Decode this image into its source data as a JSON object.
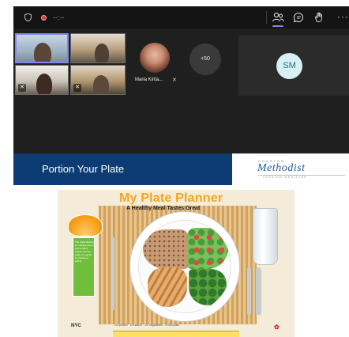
{
  "meeting": {
    "timer_text": "--:--",
    "more_label": "···",
    "participant_name": "Maria Kirtla...",
    "overflow_count": "+50",
    "sm_initials": "SM",
    "colors": {
      "accent": "#7f85f5",
      "recording": "#e03c3c",
      "stage_bg": "#1f1f1f"
    }
  },
  "slide": {
    "title": "Portion Your Plate",
    "logo_small": "HOUSTON",
    "logo_main": "Methodist",
    "logo_sub": "LEADING MEDICINE",
    "colors": {
      "band": "#0d3c74",
      "logo": "#1c5aa0"
    }
  },
  "poster": {
    "title": "My Plate Planner",
    "subtitle": "A Healthy Meal Tastes Great",
    "panel_text": "The Plate Method is a simple way to plan healthy meals. Use the plate as a guide for balanced eating.",
    "bottom_note": "1/4 protein · 1/4 starch · 1/2 vegetables · 9-inch plate",
    "nyc_label": "NYC",
    "colors": {
      "title": "#f3a61c",
      "panel": "#6fbf3c"
    }
  }
}
